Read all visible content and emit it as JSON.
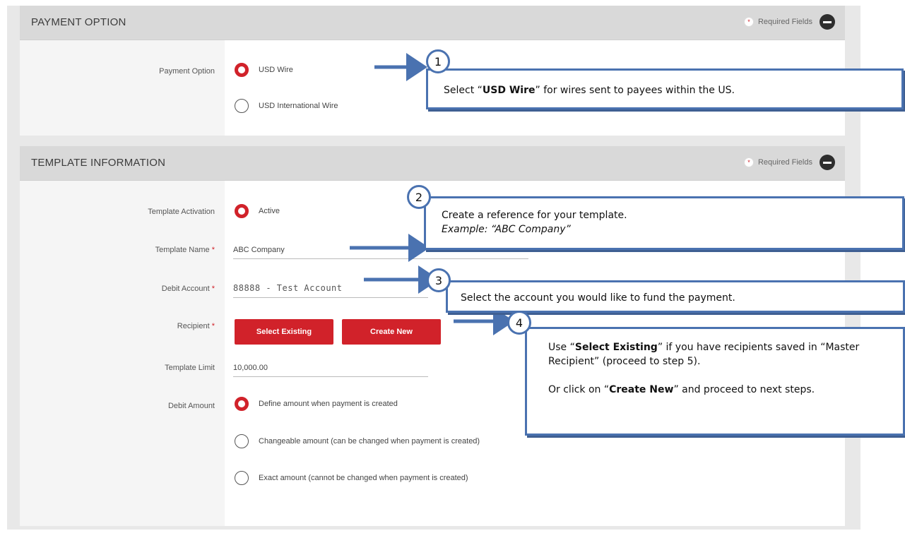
{
  "payment_option": {
    "header": "PAYMENT OPTION",
    "required_text": "Required Fields",
    "label": "Payment Option",
    "options": [
      {
        "label": "USD Wire",
        "selected": true
      },
      {
        "label": "USD International Wire",
        "selected": false
      }
    ]
  },
  "template_information": {
    "header": "TEMPLATE INFORMATION",
    "required_text": "Required Fields",
    "template_activation": {
      "label": "Template Activation",
      "value": "Active"
    },
    "template_name": {
      "label": "Template Name",
      "value": "ABC Company"
    },
    "debit_account": {
      "label": "Debit Account",
      "value": "88888 - Test Account"
    },
    "recipient": {
      "label": "Recipient",
      "select_existing": "Select Existing",
      "create_new": "Create New"
    },
    "template_limit": {
      "label": "Template Limit",
      "value": "10,000.00"
    },
    "debit_amount": {
      "label": "Debit Amount",
      "options": [
        {
          "label": "Define amount when payment is created",
          "selected": true
        },
        {
          "label": "Changeable amount (can be changed when payment is created)",
          "selected": false
        },
        {
          "label": "Exact amount (cannot be changed when payment is created)",
          "selected": false
        }
      ]
    }
  },
  "required_marker": "*",
  "callouts": [
    {
      "number": "1",
      "pre": "Select “",
      "bold": "USD Wire",
      "post": "” for wires sent to payees within the US."
    },
    {
      "number": "2",
      "line1": "Create a reference for your template.",
      "line2": "Example: “ABC Company”"
    },
    {
      "number": "3",
      "text": "Select the account you would like to fund the payment."
    },
    {
      "number": "4",
      "pre": "Use “",
      "bold": "Select Existing",
      "post": "” if you have recipients saved in “Master Recipient” (proceed to step 5).",
      "pre2": "Or click on “",
      "bold2": "Create New",
      "post2": "” and proceed to next steps."
    }
  ],
  "colors": {
    "accent": "#d1222a",
    "callout_border": "#4a72b0"
  }
}
